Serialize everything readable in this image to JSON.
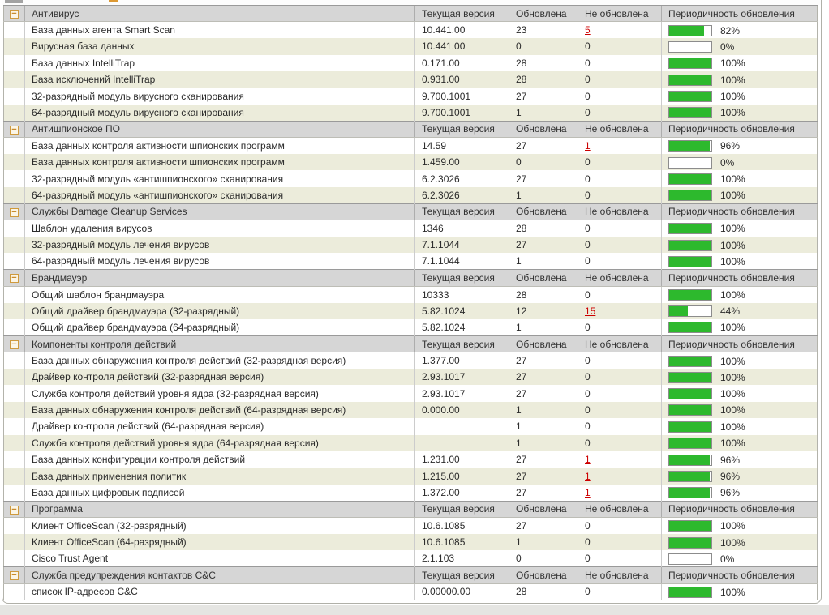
{
  "ui": {
    "collapse_glyph": "−",
    "percent_suffix": "%",
    "accent_green": "#2db92d",
    "link_red": "#cc0000"
  },
  "columns": {
    "version": "Текущая версия",
    "updated": "Обновлена",
    "not_updated": "Не обновлена",
    "rate": "Периодичность обновления"
  },
  "sections": [
    {
      "title": "Антивирус",
      "rows": [
        {
          "name": "База данных агента Smart Scan",
          "version": "10.441.00",
          "updated": "23",
          "not_updated": "5",
          "not_updated_link": true,
          "rate": 82
        },
        {
          "name": "Вирусная база данных",
          "version": "10.441.00",
          "updated": "0",
          "not_updated": "0",
          "not_updated_link": false,
          "rate": 0
        },
        {
          "name": "База данных IntelliTrap",
          "version": "0.171.00",
          "updated": "28",
          "not_updated": "0",
          "not_updated_link": false,
          "rate": 100
        },
        {
          "name": "База исключений IntelliTrap",
          "version": "0.931.00",
          "updated": "28",
          "not_updated": "0",
          "not_updated_link": false,
          "rate": 100
        },
        {
          "name": "32-разрядный модуль вирусного сканирования",
          "version": "9.700.1001",
          "updated": "27",
          "not_updated": "0",
          "not_updated_link": false,
          "rate": 100
        },
        {
          "name": "64-разрядный модуль вирусного сканирования",
          "version": "9.700.1001",
          "updated": "1",
          "not_updated": "0",
          "not_updated_link": false,
          "rate": 100
        }
      ]
    },
    {
      "title": "Антишпионское ПО",
      "rows": [
        {
          "name": "База данных контроля активности шпионских программ",
          "version": "14.59",
          "updated": "27",
          "not_updated": "1",
          "not_updated_link": true,
          "rate": 96
        },
        {
          "name": "База данных контроля активности шпионских программ",
          "version": "1.459.00",
          "updated": "0",
          "not_updated": "0",
          "not_updated_link": false,
          "rate": 0
        },
        {
          "name": "32-разрядный модуль «антишпионского» сканирования",
          "version": "6.2.3026",
          "updated": "27",
          "not_updated": "0",
          "not_updated_link": false,
          "rate": 100
        },
        {
          "name": "64-разрядный модуль «антишпионского» сканирования",
          "version": "6.2.3026",
          "updated": "1",
          "not_updated": "0",
          "not_updated_link": false,
          "rate": 100
        }
      ]
    },
    {
      "title": "Службы Damage Cleanup Services",
      "rows": [
        {
          "name": "Шаблон удаления вирусов",
          "version": "1346",
          "updated": "28",
          "not_updated": "0",
          "not_updated_link": false,
          "rate": 100
        },
        {
          "name": "32-разрядный модуль лечения вирусов",
          "version": "7.1.1044",
          "updated": "27",
          "not_updated": "0",
          "not_updated_link": false,
          "rate": 100
        },
        {
          "name": "64-разрядный модуль лечения вирусов",
          "version": "7.1.1044",
          "updated": "1",
          "not_updated": "0",
          "not_updated_link": false,
          "rate": 100
        }
      ]
    },
    {
      "title": "Брандмауэр",
      "rows": [
        {
          "name": "Общий шаблон брандмауэра",
          "version": "10333",
          "updated": "28",
          "not_updated": "0",
          "not_updated_link": false,
          "rate": 100
        },
        {
          "name": "Общий драйвер брандмауэра (32-разрядный)",
          "version": "5.82.1024",
          "updated": "12",
          "not_updated": "15",
          "not_updated_link": true,
          "rate": 44
        },
        {
          "name": "Общий драйвер брандмауэра (64-разрядный)",
          "version": "5.82.1024",
          "updated": "1",
          "not_updated": "0",
          "not_updated_link": false,
          "rate": 100
        }
      ]
    },
    {
      "title": "Компоненты контроля действий",
      "rows": [
        {
          "name": "База данных обнаружения контроля действий (32-разрядная версия)",
          "version": "1.377.00",
          "updated": "27",
          "not_updated": "0",
          "not_updated_link": false,
          "rate": 100
        },
        {
          "name": "Драйвер контроля действий (32-разрядная версия)",
          "version": "2.93.1017",
          "updated": "27",
          "not_updated": "0",
          "not_updated_link": false,
          "rate": 100
        },
        {
          "name": "Служба контроля действий уровня ядра (32-разрядная версия)",
          "version": "2.93.1017",
          "updated": "27",
          "not_updated": "0",
          "not_updated_link": false,
          "rate": 100
        },
        {
          "name": "База данных обнаружения контроля действий (64-разрядная версия)",
          "version": "0.000.00",
          "updated": "1",
          "not_updated": "0",
          "not_updated_link": false,
          "rate": 100
        },
        {
          "name": "Драйвер контроля действий (64-разрядная версия)",
          "version": "",
          "updated": "1",
          "not_updated": "0",
          "not_updated_link": false,
          "rate": 100
        },
        {
          "name": "Служба контроля действий уровня ядра (64-разрядная версия)",
          "version": "",
          "updated": "1",
          "not_updated": "0",
          "not_updated_link": false,
          "rate": 100
        },
        {
          "name": "База данных конфигурации контроля действий",
          "version": "1.231.00",
          "updated": "27",
          "not_updated": "1",
          "not_updated_link": true,
          "rate": 96
        },
        {
          "name": "База данных применения политик",
          "version": "1.215.00",
          "updated": "27",
          "not_updated": "1",
          "not_updated_link": true,
          "rate": 96
        },
        {
          "name": "База данных цифровых подписей",
          "version": "1.372.00",
          "updated": "27",
          "not_updated": "1",
          "not_updated_link": true,
          "rate": 96
        }
      ]
    },
    {
      "title": "Программа",
      "rows": [
        {
          "name": "Клиент OfficeScan (32-разрядный)",
          "version": "10.6.1085",
          "updated": "27",
          "not_updated": "0",
          "not_updated_link": false,
          "rate": 100
        },
        {
          "name": "Клиент OfficeScan (64-разрядный)",
          "version": "10.6.1085",
          "updated": "1",
          "not_updated": "0",
          "not_updated_link": false,
          "rate": 100
        },
        {
          "name": "Cisco Trust Agent",
          "version": "2.1.103",
          "updated": "0",
          "not_updated": "0",
          "not_updated_link": false,
          "rate": 0
        }
      ]
    },
    {
      "title": "Служба предупреждения контактов C&C",
      "rows": [
        {
          "name": "список IP-адресов C&C",
          "version": "0.00000.00",
          "updated": "28",
          "not_updated": "0",
          "not_updated_link": false,
          "rate": 100
        }
      ]
    }
  ]
}
